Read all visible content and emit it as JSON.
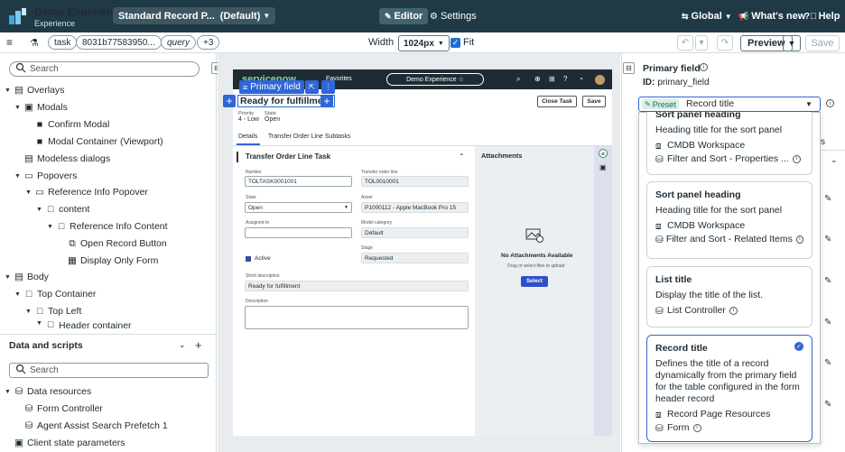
{
  "topbar": {
    "experience_title": "Demo Experience",
    "experience_subtitle": "Experience",
    "page_name": "Standard Record P...",
    "page_variant": "(Default)",
    "editor_label": "Editor",
    "settings_label": "Settings",
    "scope_label": "Global",
    "whats_new_label": "What's new",
    "help_label": "Help",
    "brand_color": "#1f3a44"
  },
  "toolbar": {
    "menu_icon": "hamburger-icon",
    "chips": [
      "task",
      "8031b77583950...",
      "query",
      "+3"
    ],
    "width_label": "Width",
    "width_value": "1024px",
    "fit_label": "Fit",
    "fit_checked": true,
    "undo_icon": "undo-icon",
    "redo_icon": "redo-icon",
    "preview_label": "Preview",
    "save_label": "Save"
  },
  "tree": {
    "search_placeholder": "Search",
    "items": [
      {
        "label": "Overlays",
        "icon": "layers-icon"
      },
      {
        "label": "Modals",
        "icon": "layers-icon"
      },
      {
        "label": "Confirm Modal",
        "icon": "square-icon"
      },
      {
        "label": "Modal Container (Viewport)",
        "icon": "square-icon"
      },
      {
        "label": "Modeless dialogs",
        "icon": "dialog-icon"
      },
      {
        "label": "Popovers",
        "icon": "popover-icon"
      },
      {
        "label": "Reference Info Popover",
        "icon": "popover-icon"
      },
      {
        "label": "content",
        "icon": "box-icon"
      },
      {
        "label": "Reference Info Content",
        "icon": "box-icon"
      },
      {
        "label": "Open Record Button",
        "icon": "button-icon"
      },
      {
        "label": "Display Only Form",
        "icon": "form-icon"
      },
      {
        "label": "Body",
        "icon": "layers-icon"
      },
      {
        "label": "Top Container",
        "icon": "box-icon"
      },
      {
        "label": "Top Left",
        "icon": "box-icon"
      },
      {
        "label": "Header container",
        "icon": "box-icon"
      }
    ]
  },
  "scripts": {
    "title": "Data and scripts",
    "search_placeholder": "Search",
    "items": [
      {
        "label": "Data resources",
        "icon": "database-icon"
      },
      {
        "label": "Form Controller",
        "icon": "database-icon"
      },
      {
        "label": "Agent Assist Search Prefetch 1",
        "icon": "database-icon"
      },
      {
        "label": "Client state parameters",
        "icon": "state-icon"
      }
    ]
  },
  "canvas": {
    "brand": "servicenow",
    "favorites": "Favorites",
    "experience_pill": "Demo Experience ☆",
    "pf_chip": "Primary field",
    "record_title": "Ready for fulfillment",
    "priority_label": "Priority",
    "priority_value": "4 - Low",
    "state_label": "State",
    "state_value": "Open",
    "close_task": "Close Task",
    "save": "Save",
    "tabs": [
      "Details",
      "Transfer Order Line Subtasks"
    ],
    "form_title": "Transfer Order Line Task",
    "fields": {
      "number_label": "Number",
      "number_value": "TOLTASK0001001",
      "tol_label": "Transfer order line",
      "tol_value": "TOL0010001",
      "state_label": "State",
      "state_value": "Open",
      "asset_label": "Asset",
      "asset_value": "P1000112 - Apple MacBook Pro 15",
      "assigned_label": "Assigned to",
      "model_label": "Model category",
      "model_value": "Default",
      "active_label": "Active",
      "stage_label": "Stage",
      "stage_value": "Requested",
      "short_desc_label": "Short description",
      "short_desc_value": "Ready for fulfillment",
      "desc_label": "Description"
    },
    "attachments_title": "Attachments",
    "no_attachments": "No Attachments Available",
    "drag_hint": "Drag or select files to upload",
    "select_label": "Select"
  },
  "config": {
    "title": "Primary field",
    "id_label": "ID:",
    "id_value": "primary_field",
    "preset_tag": "Preset",
    "preset_value": "Record title",
    "bg_tab_fragment": "s",
    "cards": [
      {
        "title": "Sort panel heading",
        "desc": "Heading title for the sort panel",
        "meta1": "CMDB Workspace",
        "meta2": "Filter and Sort - Properties ...",
        "meta2_info": true
      },
      {
        "title": "Sort panel heading",
        "desc": "Heading title for the sort panel",
        "meta1": "CMDB Workspace",
        "meta2": "Filter and Sort - Related Items",
        "meta2_info": true
      },
      {
        "title": "List title",
        "desc": "Display the title of the list.",
        "meta1": "List Controller",
        "meta1_info": true
      },
      {
        "title": "Record title",
        "desc": "Defines the title of a record dynamically from the primary field for the table configured in the form header record",
        "meta1": "Record Page Resources",
        "meta2": "Form",
        "meta2_info": true,
        "selected": true
      }
    ]
  }
}
